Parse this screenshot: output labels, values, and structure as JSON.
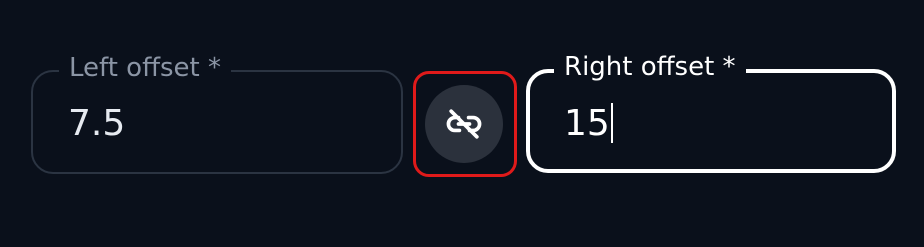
{
  "left_field": {
    "label": "Left offset",
    "required_marker": " *",
    "value": "7.5"
  },
  "right_field": {
    "label": "Right offset",
    "required_marker": " *",
    "value": "15",
    "focused": true
  },
  "link_toggle": {
    "icon": "unlink-icon",
    "state": "unlinked",
    "highlight_color": "#e01a1a"
  },
  "colors": {
    "background": "#0a101b",
    "focus_border": "#ffffff",
    "idle_border": "#2b3442",
    "button_bg": "#2b313c"
  }
}
